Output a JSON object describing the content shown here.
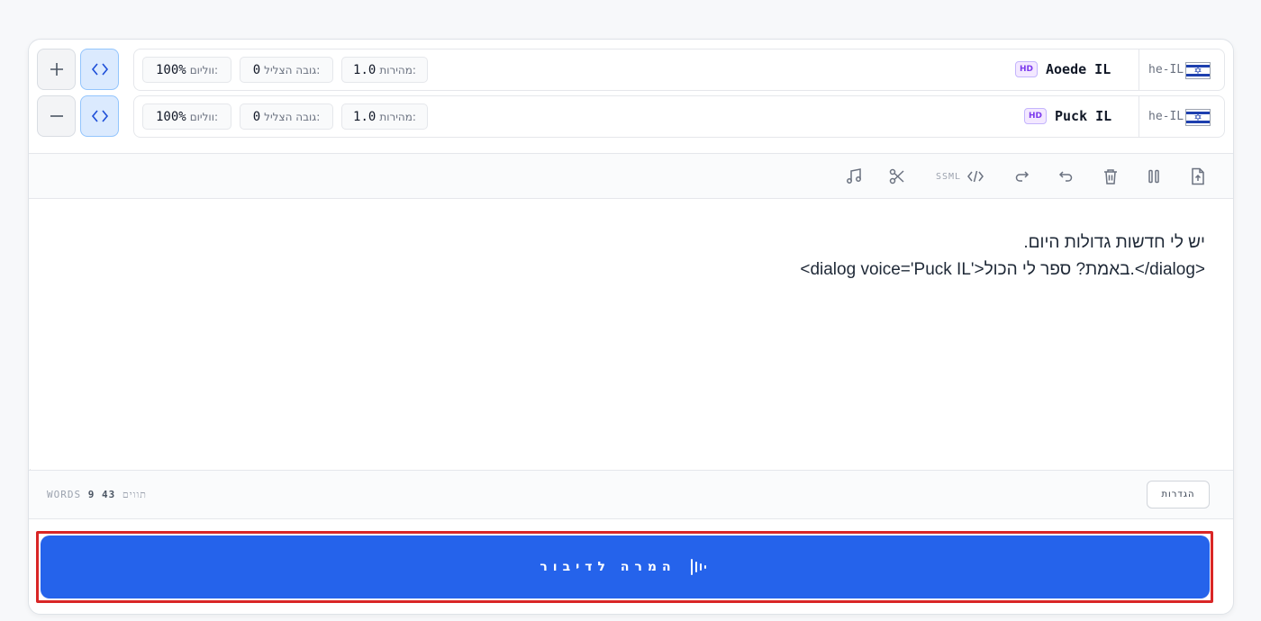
{
  "voices": [
    {
      "name": "Aoede IL",
      "badge": "HD",
      "locale": "he-IL",
      "speed_label": "מהירות:",
      "speed_value": "1.0",
      "pitch_label": "גובה הצליל:",
      "pitch_value": "0",
      "volume_label": "ווליום:",
      "volume_value": "100%",
      "action_icon": "plus-icon"
    },
    {
      "name": "Puck IL",
      "badge": "HD",
      "locale": "he-IL",
      "speed_label": "מהירות:",
      "speed_value": "1.0",
      "pitch_label": "גובה הצליל:",
      "pitch_value": "0",
      "volume_label": "ווליום:",
      "volume_value": "100%",
      "action_icon": "minus-icon"
    }
  ],
  "toolbar": {
    "ssml_label": "SSML",
    "icons": [
      "music-note-icon",
      "scissors-icon",
      "code-icon",
      "redo-icon",
      "undo-icon",
      "trash-icon",
      "pause-icon",
      "file-upload-icon"
    ]
  },
  "editor": {
    "line1": "יש לי חדשות גדולות היום.",
    "line2": "<dialog voice='Puck IL'>באמת? ספר לי הכול.</dialog>"
  },
  "footer": {
    "char_count": "43",
    "char_label": "תווים",
    "word_count": "9",
    "word_label": "WORDS",
    "settings_label": "הגדרות"
  },
  "convert": {
    "label": "המרה לדיבור",
    "icon": "audio-waveform-icon"
  },
  "colors": {
    "accent": "#2563eb",
    "highlight_frame": "#d92626",
    "badge": "#7c3aed"
  }
}
